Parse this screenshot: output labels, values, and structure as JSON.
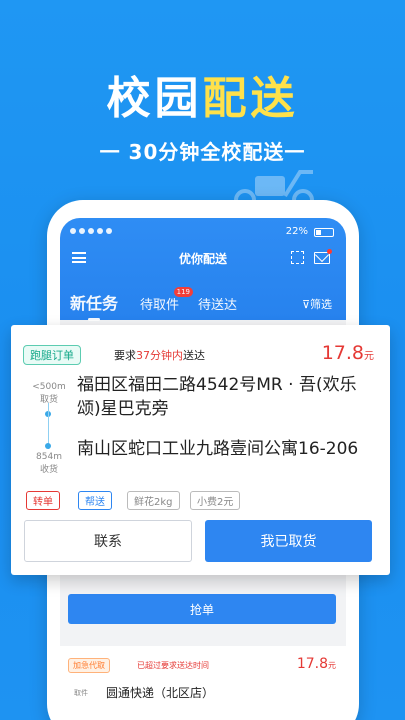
{
  "hero": {
    "title_part1": "校园",
    "title_part2": "配送",
    "subtitle": "一 30分钟全校配送一"
  },
  "status_bar": {
    "battery": "22%"
  },
  "app": {
    "title": "优你配送",
    "tabs": [
      {
        "label": "新任务"
      },
      {
        "label": "待取件",
        "badge": "119"
      },
      {
        "label": "待送达"
      }
    ],
    "filter_label": "筛选"
  },
  "order_card": {
    "tag": "跑腿订单",
    "requirement_prefix": "要求",
    "requirement_highlight": "37分钟内",
    "requirement_suffix": "送达",
    "price": "17.8",
    "price_unit": "元",
    "pickup": {
      "distance": "<500m",
      "label": "取货",
      "address": "福田区福田二路4542号MR · 吾(欢乐颂)星巴克旁"
    },
    "delivery": {
      "distance": "854m",
      "label": "收货",
      "address": "南山区蛇口工业九路壹间公寓16-206"
    },
    "chips": [
      "转单",
      "帮送",
      "鲜花2kg",
      "小费2元"
    ],
    "contact_button": "联系",
    "picked_button": "我已取货"
  },
  "grab_button": "抢单",
  "second_card": {
    "tag": "加急代取",
    "warning": "已超过要求送达时间",
    "price": "17.8",
    "price_unit": "元",
    "pickup_label": "取件",
    "address": "圆通快递（北区店）"
  },
  "colors": {
    "background": "#1f97f3",
    "accent_yellow": "#ffe14a",
    "primary_blue": "#2e86f1",
    "price_red": "#e53935"
  }
}
